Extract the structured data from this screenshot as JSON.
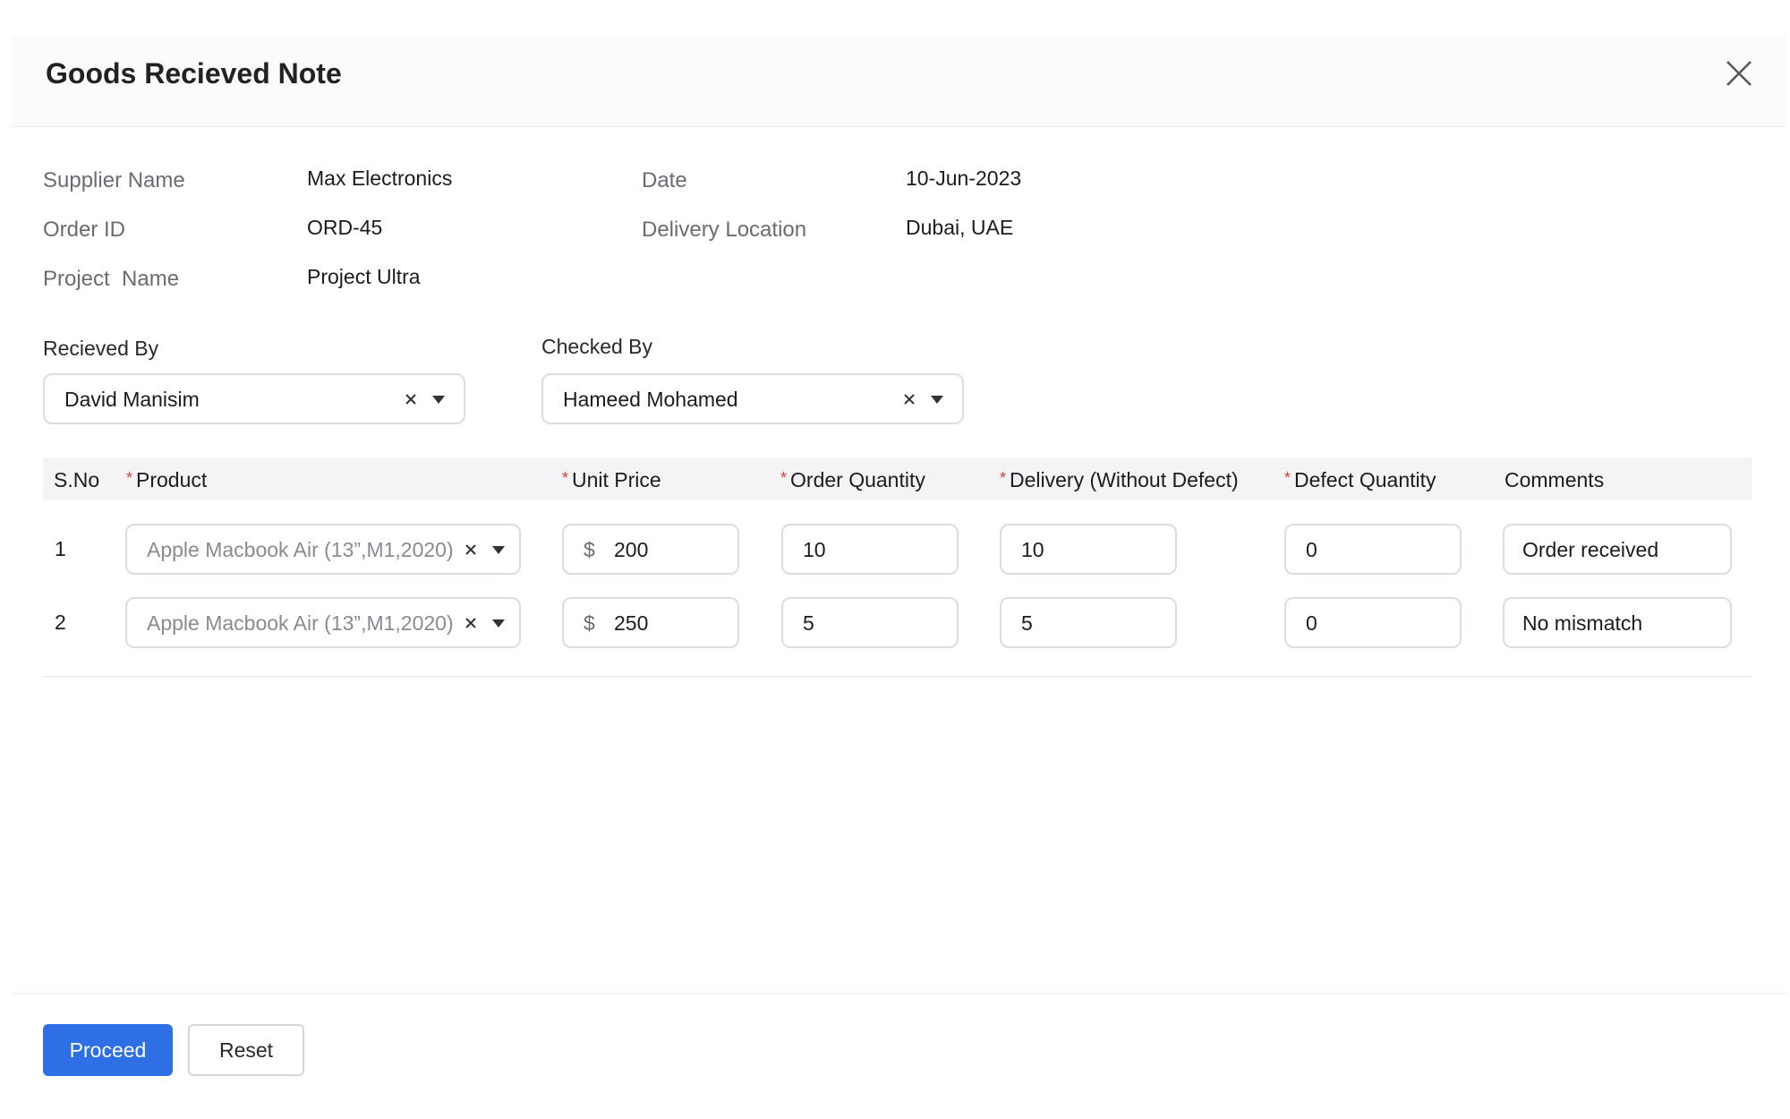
{
  "dialog": {
    "title": "Goods Recieved Note"
  },
  "info": {
    "supplier_label": "Supplier Name",
    "supplier_value": "Max Electronics",
    "order_label": "Order ID",
    "order_value": "ORD-45",
    "project_label": "Project  Name",
    "project_value": "Project Ultra",
    "date_label": "Date",
    "date_value": "10-Jun-2023",
    "location_label": "Delivery Location",
    "location_value": "Dubai, UAE"
  },
  "received_by": {
    "label": "Recieved By",
    "value": "David Manisim"
  },
  "checked_by": {
    "label": "Checked By",
    "value": "Hameed Mohamed"
  },
  "table": {
    "required_marker": "*",
    "headers": {
      "sno": "S.No",
      "product": "Product",
      "unit_price": "Unit Price",
      "order_quantity": "Order Quantity",
      "delivery": "Delivery (Without Defect)",
      "defect_quantity": "Defect Quantity",
      "comments": "Comments"
    },
    "currency_symbol": "$",
    "rows": [
      {
        "sno": "1",
        "product": "Apple Macbook Air (13”,M1,2020)",
        "unit_price": "200",
        "order_quantity": "10",
        "delivery": "10",
        "defect_quantity": "0",
        "comments": "Order received"
      },
      {
        "sno": "2",
        "product": "Apple Macbook Air (13”,M1,2020)",
        "unit_price": "250",
        "order_quantity": "5",
        "delivery": "5",
        "defect_quantity": "0",
        "comments": "No mismatch"
      }
    ]
  },
  "footer": {
    "proceed_label": "Proceed",
    "reset_label": "Reset"
  },
  "colors": {
    "primary": "#2f6fe6",
    "required": "#e03b3b"
  }
}
